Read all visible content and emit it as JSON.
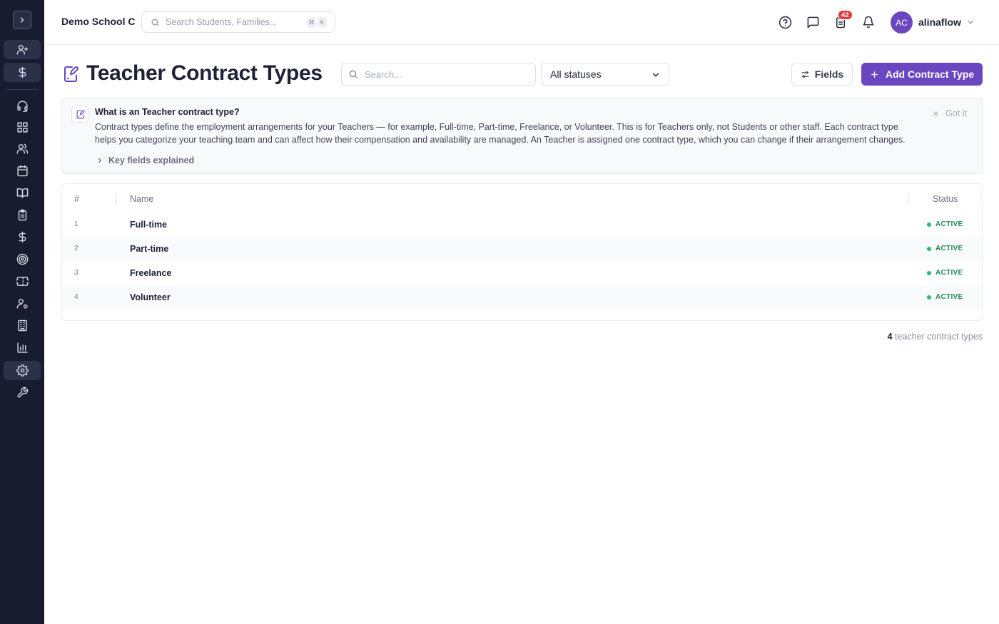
{
  "app": {
    "school_name": "Demo School C",
    "search_placeholder": "Search Students, Families...",
    "shortcut_keys": [
      "⌘",
      "K"
    ],
    "notification_count": "42",
    "user_initials": "AC",
    "username": "alinaflow",
    "accent_color": "#6b46c1"
  },
  "sidebar": {
    "icons": [
      "chevron-right-icon",
      "user-plus-icon",
      "dollar-icon",
      "headset-icon",
      "dashboard-icon",
      "users-icon",
      "calendar-icon",
      "book-icon",
      "clipboard-icon",
      "dollar-icon",
      "target-icon",
      "ticket-icon",
      "user-cog-icon",
      "building-icon",
      "bar-chart-icon",
      "gear-icon",
      "wrench-icon"
    ]
  },
  "page": {
    "title": "Teacher Contract Types",
    "search_placeholder": "Search...",
    "status_filter": "All statuses",
    "fields_label": "Fields",
    "add_label": "Add Contract Type"
  },
  "info": {
    "title": "What is an Teacher contract type?",
    "text": "Contract types define the employment arrangements for your Teachers — for example, Full-time, Part-time, Freelance, or Volunteer. This is for Teachers only, not Students or other staff. Each contract type helps you categorize your teaching team and can affect how their compensation and availability are managed. An Teacher is assigned one contract type, which you can change if their arrangement changes.",
    "key_fields_label": "Key fields explained",
    "dismiss_label": "Got it"
  },
  "table": {
    "columns": [
      "#",
      "Name",
      "Status"
    ],
    "rows": [
      {
        "num": "1",
        "name": "Full-time",
        "status": "ACTIVE"
      },
      {
        "num": "2",
        "name": "Part-time",
        "status": "ACTIVE"
      },
      {
        "num": "3",
        "name": "Freelance",
        "status": "ACTIVE"
      },
      {
        "num": "4",
        "name": "Volunteer",
        "status": "ACTIVE"
      }
    ],
    "status_color": "#1f8a56"
  },
  "footer": {
    "count": "4",
    "count_label": " teacher contract types"
  }
}
